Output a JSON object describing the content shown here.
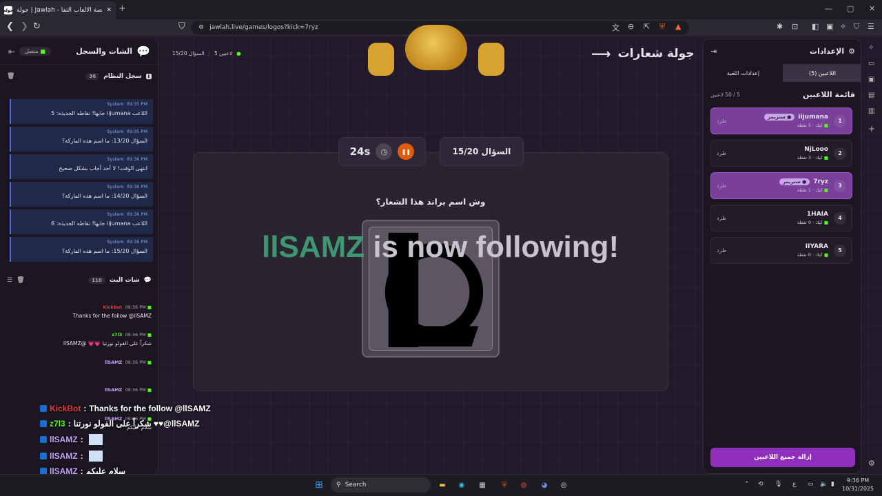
{
  "browser": {
    "tab_title": "جولة | Jawlah - منصة الألعاب التفا",
    "tab_favicon": "جولة",
    "url": "jawlah.live/games/logos?kick=7ryz"
  },
  "left": {
    "title": "الشات والسجل",
    "status": "متصل",
    "system_log": {
      "title": "سجل النظام",
      "count": "36"
    },
    "system_messages": [
      {
        "sender": "System",
        "time": "09:35 PM",
        "text": "اللاعب iijumana جابها! نقاطه الجديدة: 5"
      },
      {
        "sender": "System",
        "time": "09:35 PM",
        "text": "السؤال 13/20: ما اسم هذه الماركة؟"
      },
      {
        "sender": "System",
        "time": "09:36 PM",
        "text": "انتهى الوقت! لا أحد أجاب بشكل صحيح"
      },
      {
        "sender": "System",
        "time": "09:36 PM",
        "text": "السؤال 14/20: ما اسم هذه الماركة؟"
      },
      {
        "sender": "System",
        "time": "09:36 PM",
        "text": "اللاعب iijumana جابها! نقاطه الجديدة: 6"
      },
      {
        "sender": "System",
        "time": "09:36 PM",
        "text": "السؤال 15/20: ما اسم هذه الماركة؟"
      }
    ],
    "stream_chat": {
      "title": "شات البث",
      "count": "110"
    },
    "chat_messages": [
      {
        "user": "KickBot",
        "time": "09:36 PM",
        "text": "Thanks for the follow @llSAMZ"
      },
      {
        "user": "z7l3",
        "time": "09:36 PM",
        "text": "شكراً على الفولو نورتنا 💗💗 @llSAMZ"
      },
      {
        "user": "llSAMZ",
        "time": "09:36 PM",
        "text": ""
      },
      {
        "user": "llSAMZ",
        "time": "09:36 PM",
        "text": ""
      },
      {
        "user": "llSAMZ",
        "time": "09:36 PM",
        "text": "سلام عليكم"
      }
    ]
  },
  "center": {
    "title": "جولة شعارات",
    "players_online": "5 لاعبين",
    "question_short": "السؤال 15/20",
    "question_number": "السؤال 15/20",
    "timer": "24s",
    "question_text": "وش اسم براند هذا الشعار؟",
    "overlay_user": "llSAMZ",
    "overlay_text": " is now following!"
  },
  "stream_overlay": [
    {
      "user": "KickBot",
      "sep": " : ",
      "text": "Thanks for the follow @llSAMZ"
    },
    {
      "user": "z7l3",
      "sep": " : ",
      "text": "شكراً على الفولو نورتنا ♥♥@llSAMZ"
    },
    {
      "user": "llSAMZ",
      "sep": " : ",
      "text": ""
    },
    {
      "user": "llSAMZ",
      "sep": " : ",
      "text": ""
    },
    {
      "user": "llSAMZ",
      "sep": " : ",
      "text": "سلام عليكم"
    }
  ],
  "right": {
    "title": "الإعدادات",
    "tab_players": "اللاعبين (5)",
    "tab_settings": "إعدادات اللعبة",
    "list_title": "قائمة اللاعبين",
    "list_count": "5 / 50 لاعبين",
    "kick_label": "طرد",
    "players": [
      {
        "rank": "1",
        "name": "iijumana",
        "tag": "● ستريمر",
        "platform": "كيك",
        "points": "5 نقطة",
        "highlight": true
      },
      {
        "rank": "2",
        "name": "NjLooo",
        "tag": "",
        "platform": "كيك",
        "points": "3 نقطة",
        "highlight": false
      },
      {
        "rank": "3",
        "name": "7ryz",
        "tag": "● ستريمر",
        "platform": "كيك",
        "points": "1 نقطة",
        "highlight": true
      },
      {
        "rank": "4",
        "name": "1HAIA",
        "tag": "",
        "platform": "كيك",
        "points": "0 نقطة",
        "highlight": false
      },
      {
        "rank": "5",
        "name": "IIYARA",
        "tag": "",
        "platform": "كيك",
        "points": "0 نقطة",
        "highlight": false
      }
    ],
    "clear_button": "إزالة جميع اللاعبين"
  },
  "taskbar": {
    "search": "Search",
    "time": "9:36 PM",
    "date": "10/31/2025",
    "lang": "ع"
  },
  "colors": {
    "accent": "#8f2fbb",
    "kick_green": "#53fc18",
    "pause_orange": "#e05b0f"
  }
}
